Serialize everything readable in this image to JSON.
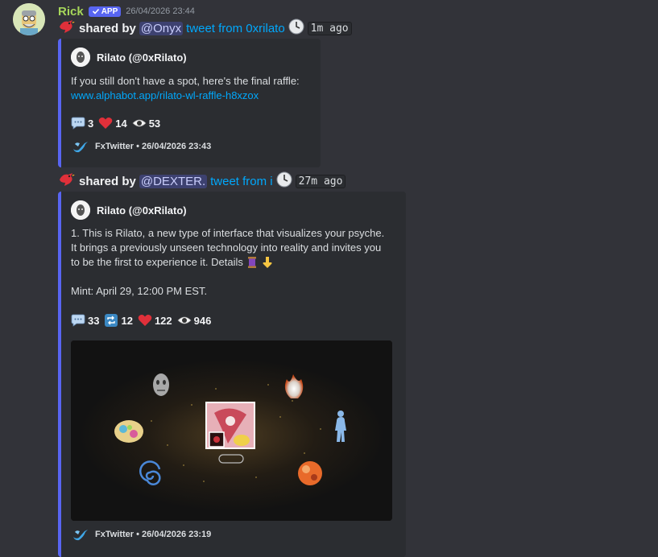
{
  "message": {
    "username": "Rick",
    "badge": "APP",
    "timestamp": "26/04/2026 23:44"
  },
  "shares": [
    {
      "shared_by": "shared by",
      "mention": "@Onyx",
      "tweet_link": "tweet from 0xrilato",
      "ago": "1m ago",
      "embed": {
        "author": "Rilato (@0xRilato)",
        "text": "If you still don't have a spot, here's the final raffle:",
        "link": "www.alphabot.app/rilato-wl-raffle-h8xzox",
        "stats": {
          "replies": "3",
          "likes": "14",
          "views": "53"
        },
        "footer": "FxTwitter • 26/04/2026 23:43"
      }
    },
    {
      "shared_by": "shared by",
      "mention": "@DEXTER.",
      "tweet_link": "tweet from i",
      "ago": "27m ago",
      "embed": {
        "author": "Rilato (@0xRilato)",
        "text_lines": [
          "1. This is Rilato, a new type of interface that visualizes your psyche.",
          "It brings a previously unseen technology into reality and invites you",
          "to be the first to experience it. Details"
        ],
        "mint": "Mint: April 29, 12:00 PM EST.",
        "stats": {
          "replies": "33",
          "retweets": "12",
          "likes": "122",
          "views": "946"
        },
        "footer": "FxTwitter • 26/04/2026 23:19"
      }
    }
  ],
  "colors": {
    "background": "#323339",
    "embed_bg": "#2b2d31",
    "embed_border": "#5865f2",
    "username": "#a6d65a",
    "link": "#00a8fc"
  }
}
